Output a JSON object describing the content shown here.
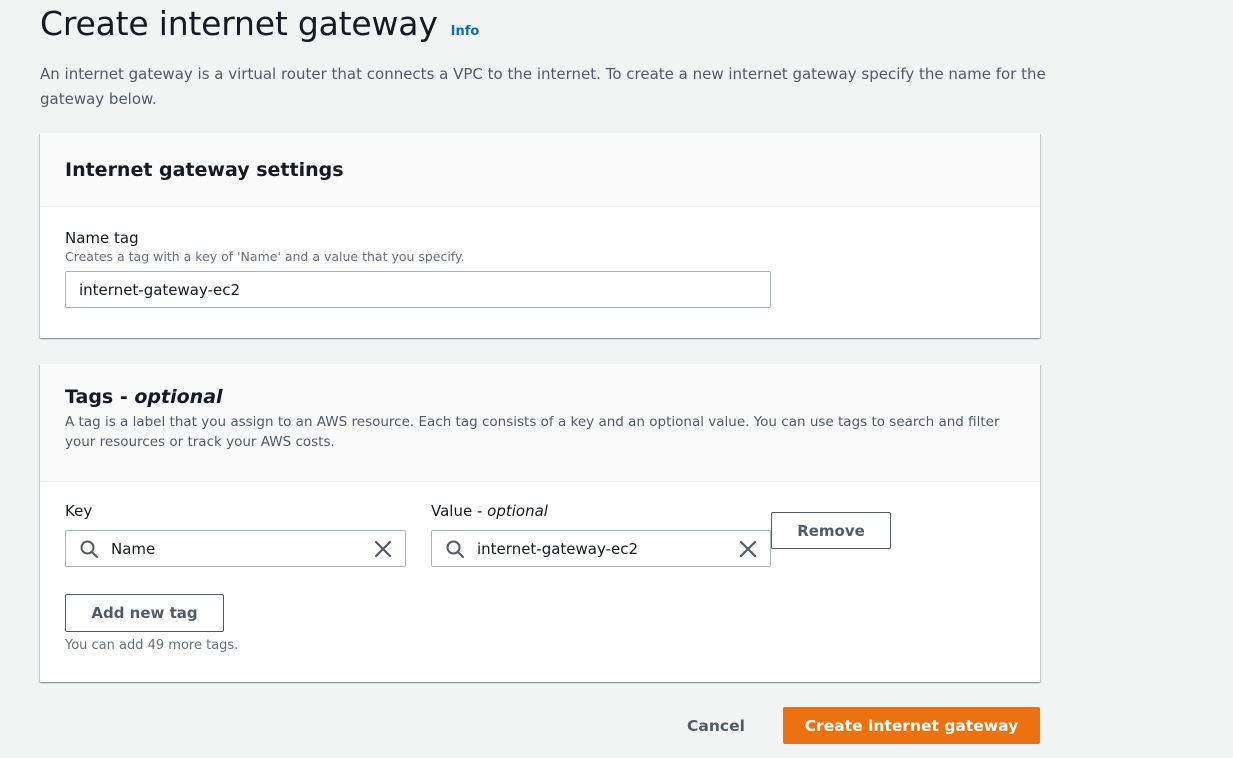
{
  "page": {
    "title": "Create internet gateway",
    "info_link": "Info",
    "description": "An internet gateway is a virtual router that connects a VPC to the internet. To create a new internet gateway specify the name for the gateway below."
  },
  "settings_panel": {
    "title": "Internet gateway settings",
    "name_tag": {
      "label": "Name tag",
      "description": "Creates a tag with a key of 'Name' and a value that you specify.",
      "value": "internet-gateway-ec2"
    }
  },
  "tags_panel": {
    "title_main": "Tags - ",
    "title_optional": "optional",
    "description": "A tag is a label that you assign to an AWS resource. Each tag consists of a key and an optional value. You can use tags to search and filter your resources or track your AWS costs.",
    "key_label": "Key",
    "value_label_main": "Value - ",
    "value_label_optional": "optional",
    "tags": [
      {
        "key": "Name",
        "value": "internet-gateway-ec2"
      }
    ],
    "remove_label": "Remove",
    "add_label": "Add new tag",
    "hint": "You can add 49 more tags."
  },
  "footer": {
    "cancel_label": "Cancel",
    "create_label": "Create internet gateway"
  },
  "colors": {
    "primary_button": "#ec7211",
    "link": "#0073bb",
    "background": "#f2f3f3"
  },
  "icons": {
    "search": "search-icon",
    "clear": "close-icon"
  }
}
